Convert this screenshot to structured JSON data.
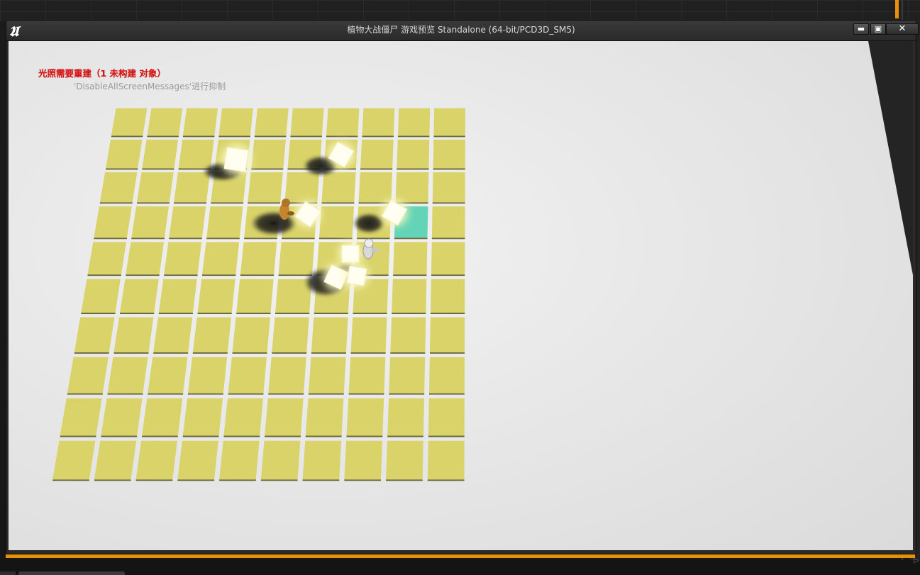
{
  "window": {
    "title": "植物大战僵尸 游戏预览 Standalone (64-bit/PCD3D_SM5)",
    "logo_icon": "unreal-engine-logo",
    "controls": {
      "minimize_icon": "minimize-icon",
      "maximize_icon": "maximize-icon",
      "close_icon": "close-icon"
    }
  },
  "viewport": {
    "lighting_warning": "光照需要重建（1 未构建 对象）",
    "suppress_hint": "'DisableAllScreenMessages'进行抑制"
  },
  "colors": {
    "tile": "#d9d36a",
    "tile_highlight": "#63d4b6",
    "floor": "#e4e4e4",
    "warning_text": "#e01010",
    "accent_wire": "#e8900c"
  },
  "board": {
    "rows": 10,
    "columns": 10,
    "highlighted_tile": {
      "row": 4,
      "column": 9
    }
  }
}
